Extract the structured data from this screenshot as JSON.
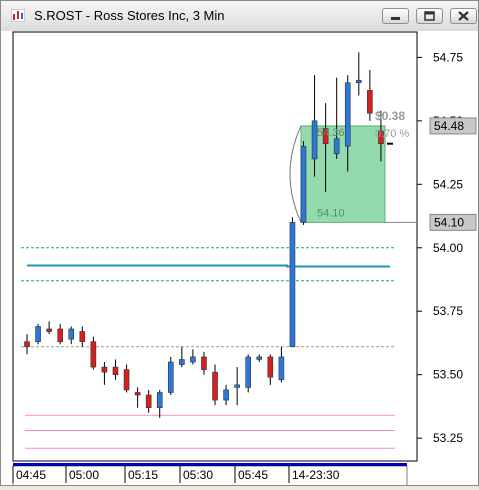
{
  "window": {
    "title": "S.ROST - Ross Stores Inc, 3 Min",
    "buttons": [
      "minimize",
      "restore",
      "close"
    ]
  },
  "chart_data": {
    "type": "candlestick",
    "symbol": "S.ROST",
    "interval": "3 Min",
    "ylim": [
      53.16,
      54.85
    ],
    "y_ticks": [
      "54.75",
      "54.50",
      "54.25",
      "54.00",
      "53.75",
      "53.50",
      "53.25"
    ],
    "x_ticks": [
      "04:45",
      "05:00",
      "05:15",
      "05:30",
      "05:45",
      "14-23:30"
    ],
    "candles": [
      {
        "o": 53.63,
        "h": 53.66,
        "l": 53.58,
        "c": 53.61,
        "dir": "down"
      },
      {
        "o": 53.63,
        "h": 53.7,
        "l": 53.62,
        "c": 53.69,
        "dir": "up"
      },
      {
        "o": 53.68,
        "h": 53.71,
        "l": 53.66,
        "c": 53.67,
        "dir": "down"
      },
      {
        "o": 53.68,
        "h": 53.7,
        "l": 53.62,
        "c": 53.63,
        "dir": "down"
      },
      {
        "o": 53.64,
        "h": 53.69,
        "l": 53.62,
        "c": 53.68,
        "dir": "up"
      },
      {
        "o": 53.67,
        "h": 53.69,
        "l": 53.61,
        "c": 53.63,
        "dir": "down"
      },
      {
        "o": 53.63,
        "h": 53.65,
        "l": 53.52,
        "c": 53.53,
        "dir": "down"
      },
      {
        "o": 53.53,
        "h": 53.55,
        "l": 53.46,
        "c": 53.51,
        "dir": "down"
      },
      {
        "o": 53.53,
        "h": 53.56,
        "l": 53.48,
        "c": 53.5,
        "dir": "down"
      },
      {
        "o": 53.52,
        "h": 53.54,
        "l": 53.43,
        "c": 53.44,
        "dir": "down"
      },
      {
        "o": 53.43,
        "h": 53.45,
        "l": 53.37,
        "c": 53.42,
        "dir": "down"
      },
      {
        "o": 53.42,
        "h": 53.44,
        "l": 53.35,
        "c": 53.37,
        "dir": "down"
      },
      {
        "o": 53.37,
        "h": 53.44,
        "l": 53.33,
        "c": 53.43,
        "dir": "up"
      },
      {
        "o": 53.43,
        "h": 53.57,
        "l": 53.42,
        "c": 53.55,
        "dir": "up"
      },
      {
        "o": 53.54,
        "h": 53.61,
        "l": 53.53,
        "c": 53.56,
        "dir": "up"
      },
      {
        "o": 53.55,
        "h": 53.6,
        "l": 53.54,
        "c": 53.57,
        "dir": "up"
      },
      {
        "o": 53.57,
        "h": 53.59,
        "l": 53.5,
        "c": 53.52,
        "dir": "down"
      },
      {
        "o": 53.51,
        "h": 53.54,
        "l": 53.38,
        "c": 53.4,
        "dir": "down"
      },
      {
        "o": 53.4,
        "h": 53.46,
        "l": 53.38,
        "c": 53.44,
        "dir": "up"
      },
      {
        "o": 53.45,
        "h": 53.53,
        "l": 53.38,
        "c": 53.46,
        "dir": "up"
      },
      {
        "o": 53.45,
        "h": 53.58,
        "l": 53.43,
        "c": 53.57,
        "dir": "up"
      },
      {
        "o": 53.56,
        "h": 53.58,
        "l": 53.55,
        "c": 53.57,
        "dir": "up"
      },
      {
        "o": 53.57,
        "h": 53.58,
        "l": 53.46,
        "c": 53.49,
        "dir": "down"
      },
      {
        "o": 53.48,
        "h": 53.61,
        "l": 53.47,
        "c": 53.57,
        "dir": "up"
      },
      {
        "o": 53.61,
        "h": 54.12,
        "l": 53.61,
        "c": 54.1,
        "dir": "up"
      },
      {
        "o": 54.1,
        "h": 54.42,
        "l": 54.09,
        "c": 54.4,
        "dir": "up"
      },
      {
        "o": 54.35,
        "h": 54.68,
        "l": 54.28,
        "c": 54.5,
        "dir": "up"
      },
      {
        "o": 54.47,
        "h": 54.57,
        "l": 54.22,
        "c": 54.41,
        "dir": "down"
      },
      {
        "o": 54.37,
        "h": 54.67,
        "l": 54.35,
        "c": 54.43,
        "dir": "up"
      },
      {
        "o": 54.4,
        "h": 54.68,
        "l": 54.3,
        "c": 54.65,
        "dir": "up"
      },
      {
        "o": 54.65,
        "h": 54.77,
        "l": 54.6,
        "c": 54.66,
        "dir": "up"
      },
      {
        "o": 54.62,
        "h": 54.7,
        "l": 54.5,
        "c": 54.53,
        "dir": "down"
      },
      {
        "o": 54.46,
        "h": 54.54,
        "l": 54.34,
        "c": 54.41,
        "dir": "down"
      }
    ],
    "overlays": {
      "green_dashed": [
        54.0,
        53.87
      ],
      "teal_solid": 53.93,
      "gray_dashed": 53.61,
      "pink_lines": [
        53.34,
        53.28,
        53.21
      ]
    },
    "measure_box": {
      "from": 54.1,
      "to": 54.48,
      "start_label": "54.10",
      "end_label": "54.36",
      "change": "$0.38",
      "percent": "0.70 %"
    },
    "price_tags": [
      {
        "label": "54.48",
        "value": 54.48
      },
      {
        "label": "54.10",
        "value": 54.1
      }
    ]
  }
}
